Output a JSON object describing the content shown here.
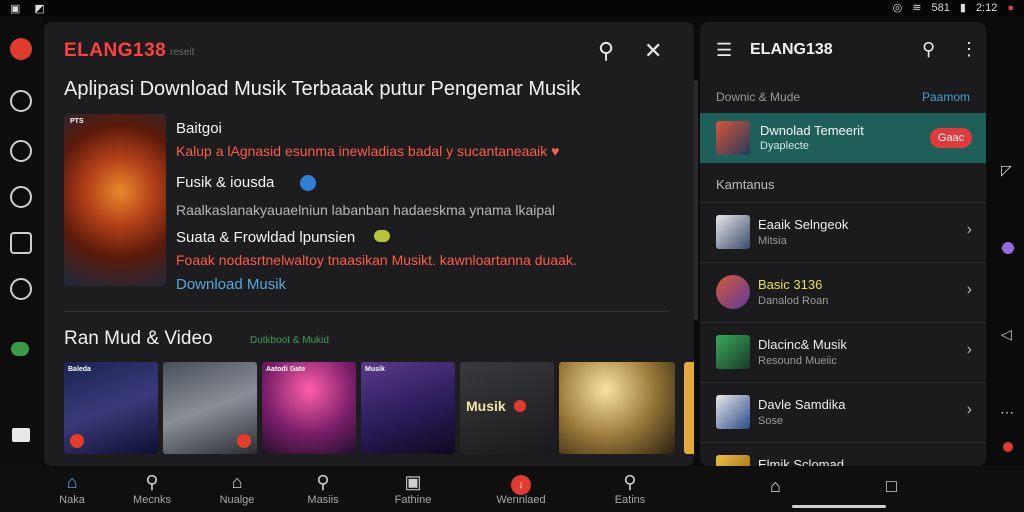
{
  "status": {
    "signal": "581",
    "time": "2:12"
  },
  "brand": {
    "name": "ELANG138",
    "sub": "reseit",
    "accent": "#ff4040"
  },
  "main": {
    "title": "Aplipasi Download Musik Terbaaak putur Pengemar Musik",
    "features": [
      {
        "text": "Baitgoi",
        "style": "h"
      },
      {
        "text": "Kalup a lAgnasid esunma inewladias badal y sucantaneaaik ♥",
        "style": "red"
      },
      {
        "text": "Fusik & iousda",
        "style": "h"
      },
      {
        "text": "Raalkaslanakyauaelniun labanban hadaeskma ynama lkaipal",
        "style": "grey"
      },
      {
        "text": "Suata & Frowldad lpunsien",
        "style": "h"
      },
      {
        "text": "Foaak nodasrtnelwaltoy tnaasikan Musikt.   kawnloartanna duaak.",
        "style": "red"
      },
      {
        "text": "Download Musik",
        "style": "link"
      }
    ],
    "poster_tag": "PTS",
    "section_title": "Ran Mud & Video",
    "section_sub": "Dutkboot & Mukid",
    "thumbs": [
      {
        "label": "Baleda"
      },
      {
        "label": ""
      },
      {
        "label": "Aatodi Gate"
      },
      {
        "label": "Musik"
      },
      {
        "label": "Musik"
      },
      {
        "label": ""
      },
      {
        "label": ""
      }
    ]
  },
  "side": {
    "brand": "ELANG138",
    "section_label": "Downic & Mude",
    "section_action": "Paamom",
    "highlight": {
      "title": "Dwnolad Temeerit",
      "subtitle": "Dyaplecte",
      "pill": "Gaac"
    },
    "category": "Kamtanus",
    "items": [
      {
        "title": "Eaaik Selngeok",
        "subtitle": "Mitsia"
      },
      {
        "title": "Basic 3136",
        "subtitle": "Danalod Roan"
      },
      {
        "title": "Dlacinc& Musik",
        "subtitle": "Resound Mueiic"
      },
      {
        "title": "Davle Samdika",
        "subtitle": "Sose"
      },
      {
        "title": "Elmik Sclomad",
        "subtitle": ""
      }
    ]
  },
  "nav": [
    {
      "label": "Naka",
      "icon": "home-icon"
    },
    {
      "label": "Mecnks",
      "icon": "search-icon"
    },
    {
      "label": "Nualge",
      "icon": "library-icon"
    },
    {
      "label": "Masiis",
      "icon": "search-icon"
    },
    {
      "label": "Fathine",
      "icon": "image-icon"
    },
    {
      "label": "Wennlaed",
      "icon": "download-icon"
    },
    {
      "label": "Eatins",
      "icon": "chat-icon"
    }
  ]
}
